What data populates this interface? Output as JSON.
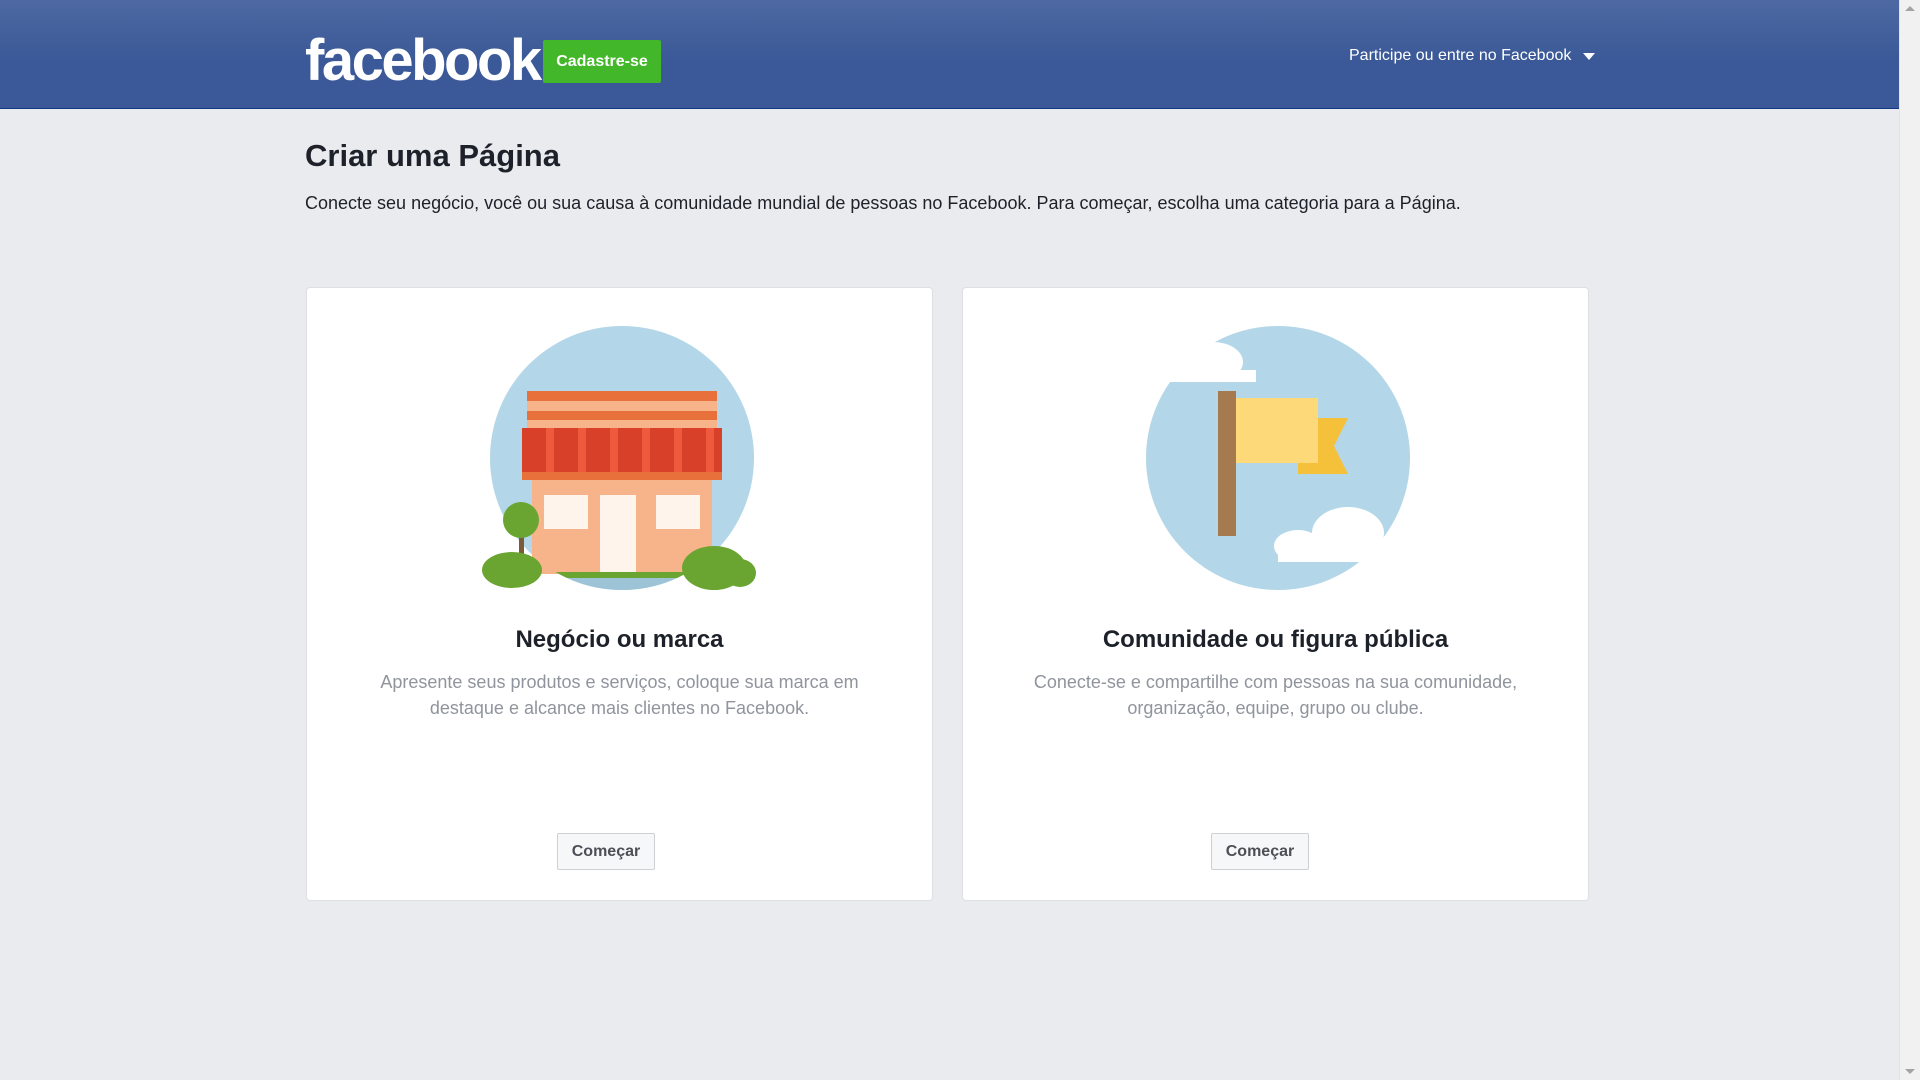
{
  "header": {
    "logo_text": "facebook",
    "signup_label": "Cadastre-se",
    "login_menu_label": "Participe ou entre no Facebook"
  },
  "main": {
    "title": "Criar uma Página",
    "intro": "Conecte seu negócio, você ou sua causa à comunidade mundial de pessoas no Facebook. Para começar, escolha uma categoria para a Página.",
    "cards": [
      {
        "title": "Negócio ou marca",
        "description": "Apresente seus produtos e serviços, coloque sua marca em destaque e alcance mais clientes no Facebook.",
        "button_label": "Começar",
        "illustration": "storefront-illustration"
      },
      {
        "title": "Comunidade ou figura pública",
        "description": "Conecte-se e compartilhe com pessoas na sua comunidade, organização, equipe, grupo ou clube.",
        "button_label": "Começar",
        "illustration": "flag-illustration"
      }
    ]
  },
  "colors": {
    "header_blue": "#3b5998",
    "signup_green": "#42b72a",
    "page_bg": "#e9ebee",
    "illustration_circle": "#b3d7e8"
  }
}
